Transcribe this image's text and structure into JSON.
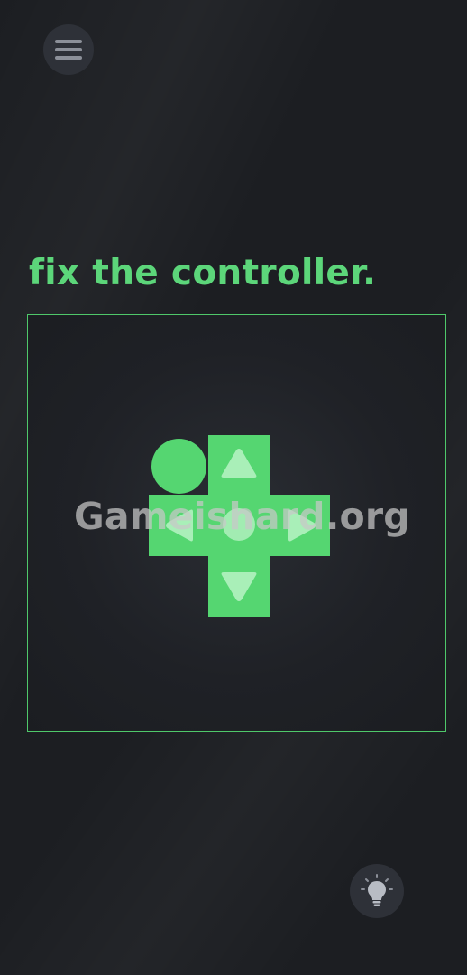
{
  "header": {
    "menu_icon": "hamburger-menu-icon"
  },
  "level": {
    "title": "fix the controller."
  },
  "controller": {
    "ball_color": "#55d671",
    "dpad_color": "#55d671",
    "arrow_color": "#dff7e4",
    "frame_color": "#4fc86a",
    "arrows": [
      "up-arrow-icon",
      "left-arrow-icon",
      "right-arrow-icon",
      "down-arrow-icon"
    ]
  },
  "watermark": {
    "text": "Gameishard.org"
  },
  "footer": {
    "hint_icon": "lightbulb-icon"
  },
  "colors": {
    "background": "#1c1e22",
    "accent": "#5cd67a",
    "button_bg": "#2e3138"
  }
}
